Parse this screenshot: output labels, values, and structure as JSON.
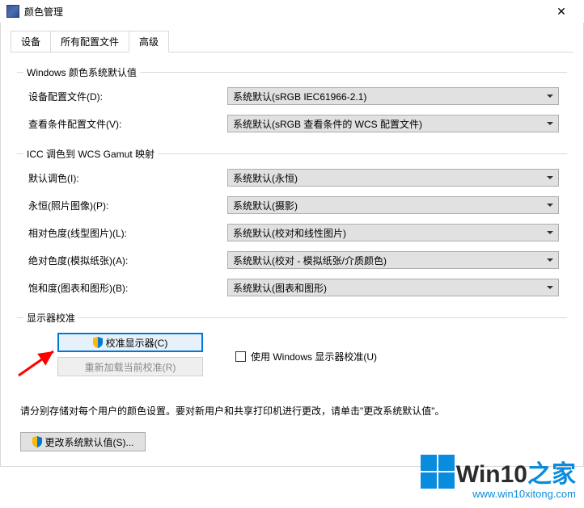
{
  "window": {
    "title": "颜色管理",
    "close": "✕"
  },
  "tabs": [
    {
      "label": "设备"
    },
    {
      "label": "所有配置文件"
    },
    {
      "label": "高级"
    }
  ],
  "group1": {
    "title": "Windows 颜色系统默认值",
    "rows": [
      {
        "label": "设备配置文件(D):",
        "value": "系统默认(sRGB IEC61966-2.1)"
      },
      {
        "label": "查看条件配置文件(V):",
        "value": "系统默认(sRGB 查看条件的 WCS 配置文件)"
      }
    ]
  },
  "group2": {
    "title": "ICC 调色到 WCS Gamut 映射",
    "rows": [
      {
        "label": "默认调色(I):",
        "value": "系统默认(永恒)"
      },
      {
        "label": "永恒(照片图像)(P):",
        "value": "系统默认(摄影)"
      },
      {
        "label": "相对色度(线型图片)(L):",
        "value": "系统默认(校对和线性图片)"
      },
      {
        "label": "绝对色度(模拟纸张)(A):",
        "value": "系统默认(校对 - 模拟纸张/介质颜色)"
      },
      {
        "label": "饱和度(图表和图形)(B):",
        "value": "系统默认(图表和图形)"
      }
    ]
  },
  "group3": {
    "title": "显示器校准",
    "calibrate_btn": "校准显示器(C)",
    "reload_btn": "重新加载当前校准(R)",
    "checkbox_label": "使用 Windows 显示器校准(U)"
  },
  "note": "请分别存储对每个用户的颜色设置。要对新用户和共享打印机进行更改，请单击\"更改系统默认值\"。",
  "change_defaults_btn": "更改系统默认值(S)...",
  "watermark": {
    "brand1": "Win10",
    "brand2": "之家",
    "url": "www.win10xitong.com"
  }
}
